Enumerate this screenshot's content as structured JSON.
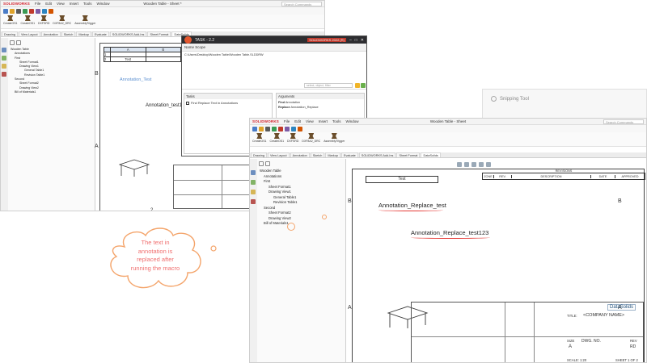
{
  "left_window": {
    "brand": "SOLIDWORKS",
    "menu": [
      "File",
      "Edit",
      "View",
      "Insert",
      "Tools",
      "Window"
    ],
    "title": "Wooden Table - Sheet *",
    "search_placeholder": "Search Commands",
    "command_tabs": [
      "CreateOS1",
      "CreateOS1",
      "DXFSRD",
      "DXF8A2_DRC",
      "AssemblyTrigger"
    ],
    "doc_tabs": [
      "Drawing",
      "View Layout",
      "Annotation",
      "Sketch",
      "Markup",
      "Evaluate",
      "SOLIDWORKS Add-Ins",
      "Sheet Format",
      "DataSolids"
    ],
    "tree": [
      "Wooden Table",
      "Annotations",
      "First",
      "Sheet Format1",
      "Drawing View1",
      "General Table1",
      "Revision Table1",
      "Second",
      "Sheet Format2",
      "Drawing View2",
      "Bill of Materials1"
    ],
    "table_headers": [
      "A",
      "B"
    ],
    "table_rows": [
      [
        "1",
        "",
        ""
      ],
      [
        "2",
        "Test",
        ""
      ]
    ],
    "zone_b": "B",
    "zone_a": "A",
    "anno1": "Annotation_Test",
    "anno2": "Annotation_test123",
    "bottom_num": "2"
  },
  "task_dialog": {
    "title": "TASK - 2.2",
    "solidworks_badge": "SOLIDWORKS 2022 (R)",
    "name_scope_label": "Name Scope",
    "path": "C:\\Users\\Desktop\\Wooden Table\\Wooden Table.SLDDRW",
    "filter_placeholder": "select, object, filter",
    "tasks_label": "Tasks",
    "task_item": "Find Replace Text in Annotations",
    "arguments_label": "Arguments",
    "arg_rows": [
      [
        "Find",
        "Annotation"
      ],
      [
        "Replace",
        "Annotation_Replace"
      ]
    ]
  },
  "snipping_tool": {
    "title": "Snipping Tool"
  },
  "callout": {
    "text": [
      "The text in",
      "annotation is",
      "replaced after",
      "running the macro"
    ]
  },
  "right_window": {
    "brand": "SOLIDWORKS",
    "menu": [
      "File",
      "Edit",
      "View",
      "Insert",
      "Tools",
      "Window"
    ],
    "title": "Wooden Table - Sheet",
    "search_placeholder": "Search Commands",
    "command_tabs": [
      "CreateOS1",
      "CreateOS1",
      "DXFSRD",
      "DXF8A2_DRC",
      "AssemblyTrigger"
    ],
    "doc_tabs": [
      "Drawing",
      "View Layout",
      "Annotation",
      "Sketch",
      "Markup",
      "Evaluate",
      "SOLIDWORKS Add-Ins",
      "Sheet Format",
      "DataSolids"
    ],
    "tree": [
      "Wooden Table",
      "Annotations",
      "First",
      "Sheet Format1",
      "Drawing View1",
      "General Table1",
      "Revision Table1",
      "Second",
      "Sheet Format2",
      "Drawing View2",
      "Bill of Materials1"
    ],
    "table_cell": "Test",
    "rev_headers": [
      "ZONE",
      "REV.",
      "DESCRIPTION",
      "DATE",
      "APPROVED"
    ],
    "revisions_label": "REVISIONS",
    "zone_b": "B",
    "zone_a": "A",
    "anno1": "Annotation_Replace_test",
    "anno2": "Annotation_Replace_test123",
    "title_block": {
      "logo": "DataSolids",
      "title_label": "TITLE:",
      "company": "<COMPANY NAME>",
      "size_label": "SIZE",
      "size": "A",
      "dwg_label": "DWG. NO.",
      "rev_label": "REV",
      "rev": "RD",
      "scale_label": "SCALE: 1:20",
      "sheet_label": "SHEET 1 OF 2"
    }
  }
}
